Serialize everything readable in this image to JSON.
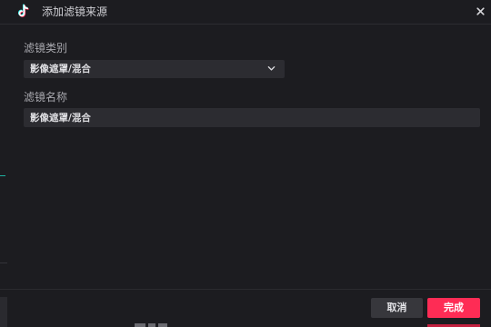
{
  "window": {
    "title": "添加滤镜来源"
  },
  "form": {
    "category_label": "滤镜类别",
    "category_value": "影像遮罩/混合",
    "name_label": "滤镜名称",
    "name_value": "影像遮罩/混合"
  },
  "footer": {
    "cancel_label": "取消",
    "done_label": "完成"
  },
  "icons": {
    "app_logo": "tiktok-logo-icon",
    "close": "close-icon",
    "dropdown": "chevron-down-icon"
  },
  "colors": {
    "background": "#1c1c20",
    "input_bg": "#2c2c31",
    "accent_primary": "#fe2c55",
    "logo_cyan": "#25f4ee",
    "logo_red": "#fe2c55"
  }
}
